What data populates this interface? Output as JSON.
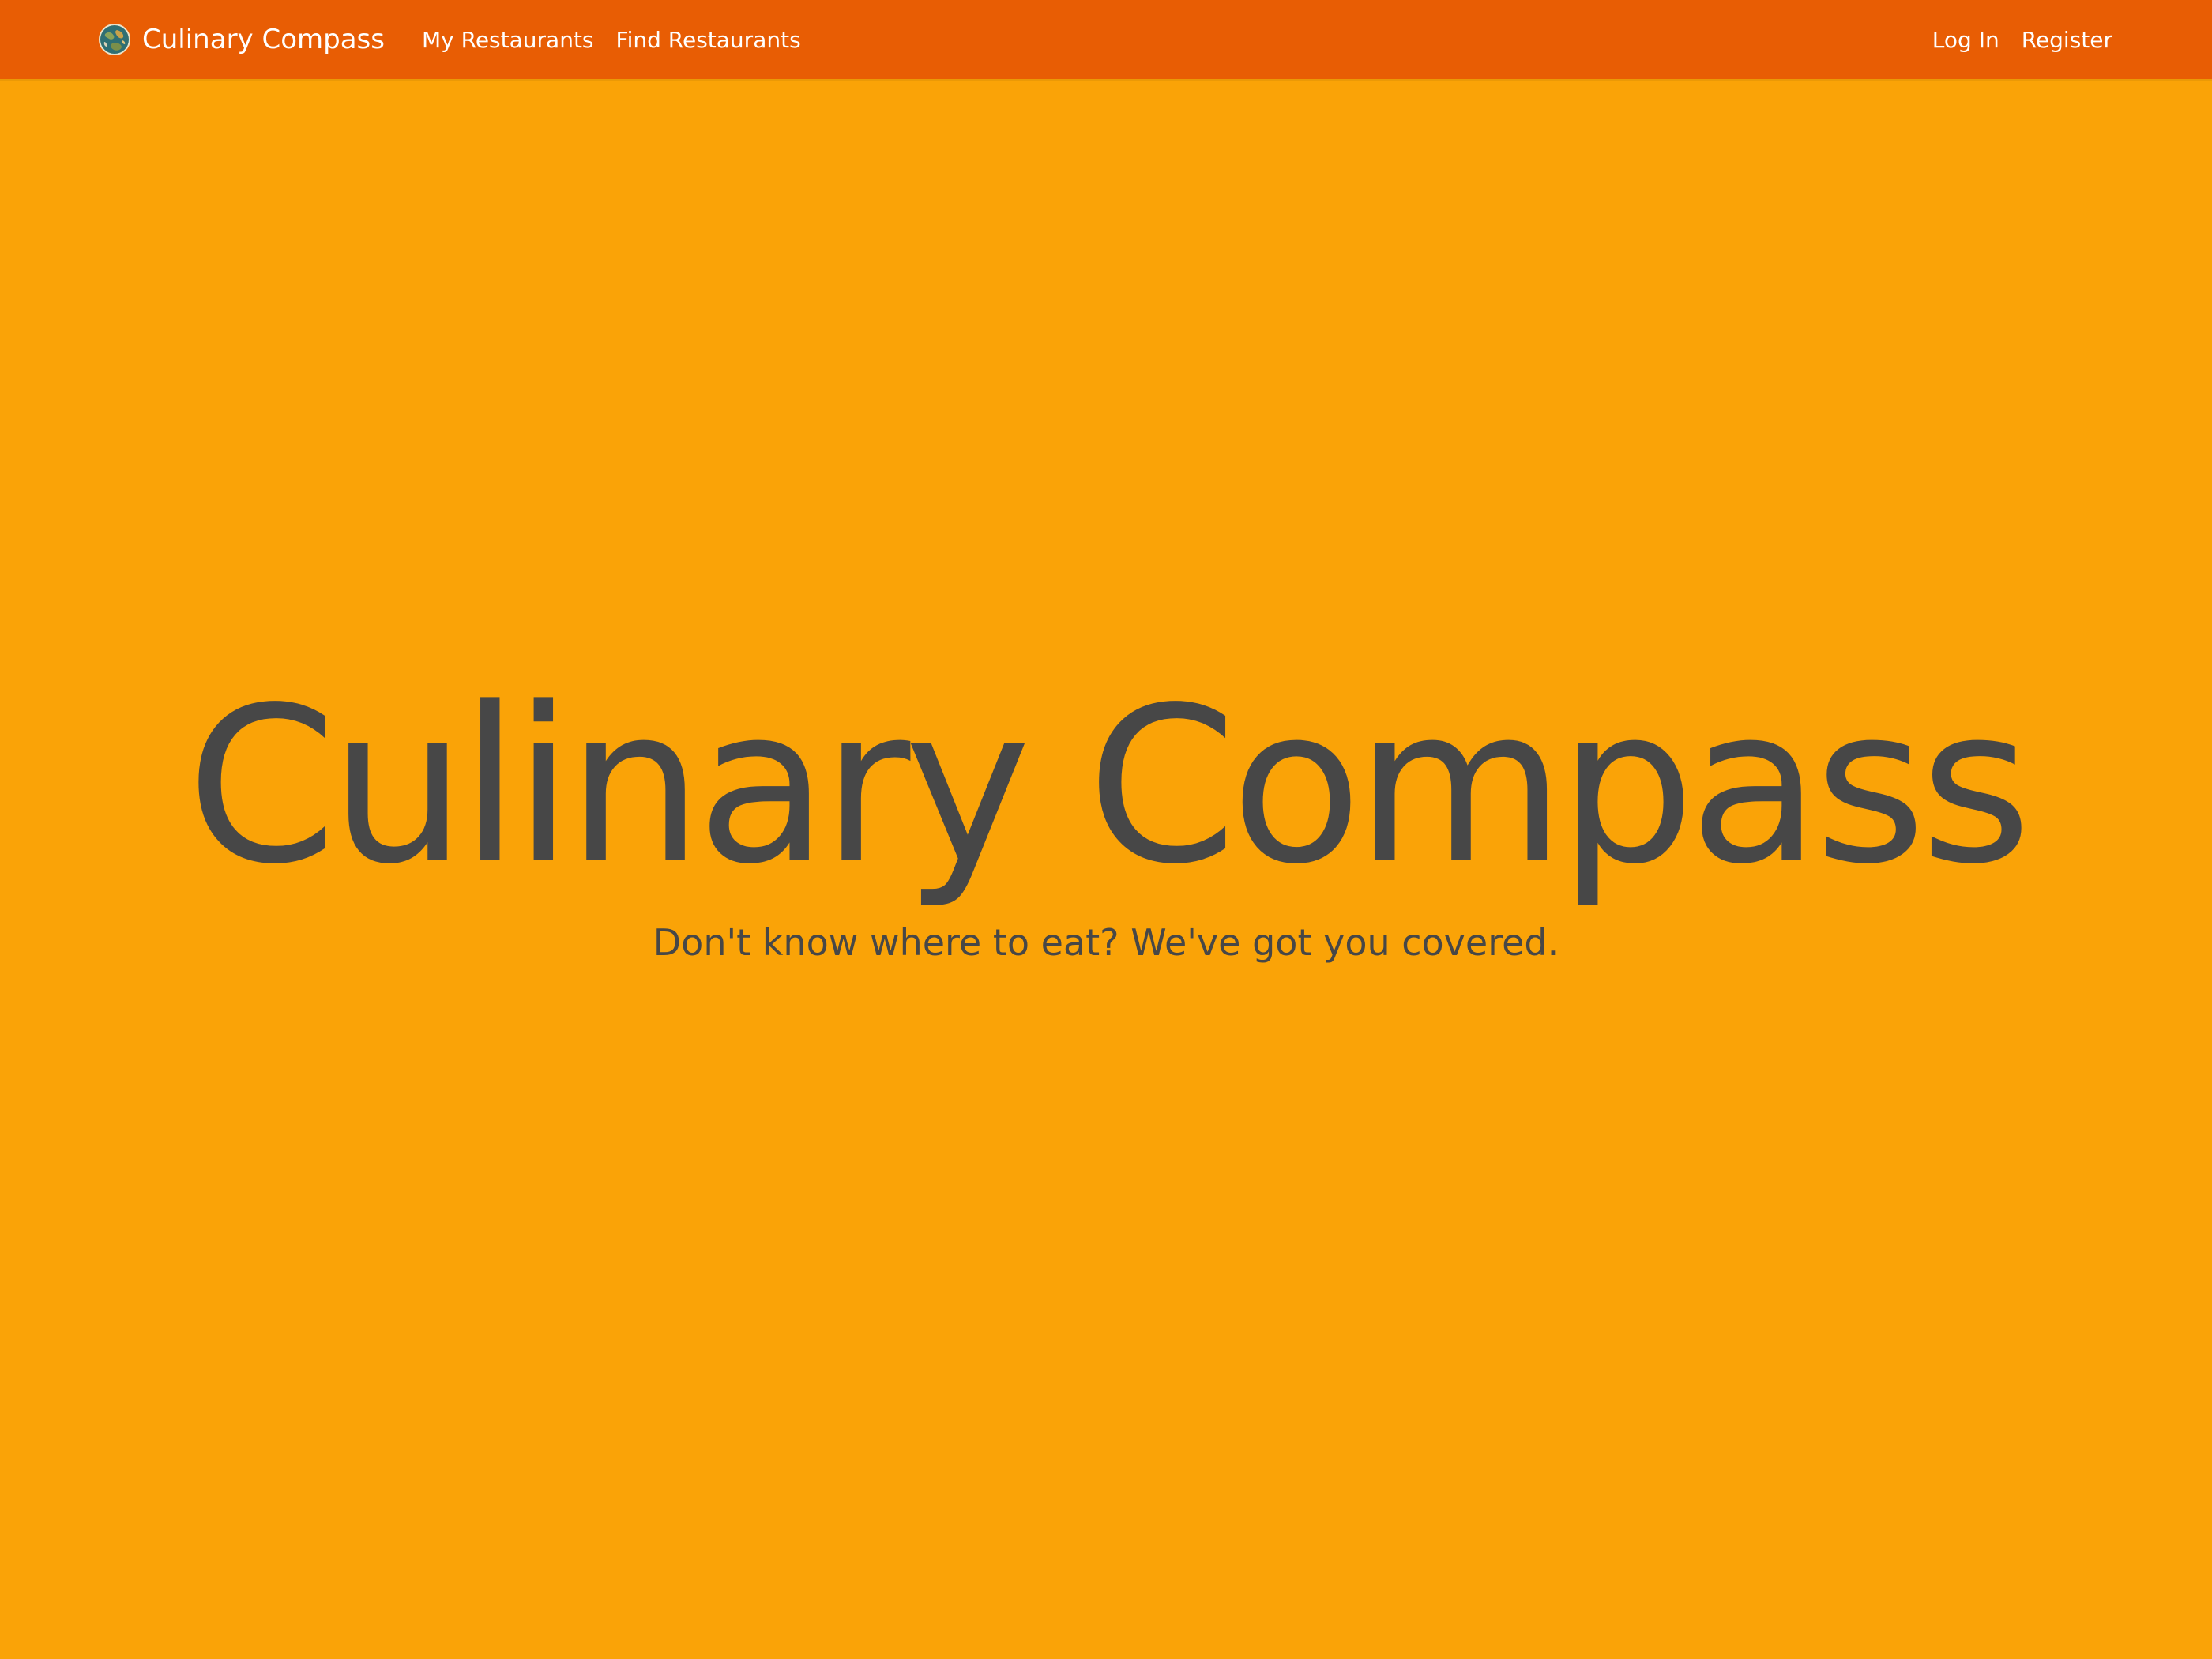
{
  "colors": {
    "navbar_bg": "#E85D04",
    "page_bg": "#FAA307",
    "hero_text": "#474747",
    "nav_text": "#FFFFFF"
  },
  "navbar": {
    "brand": {
      "icon": "globe-logo-icon",
      "label": "Culinary Compass"
    },
    "links_left": [
      {
        "label": "My Restaurants"
      },
      {
        "label": "Find Restaurants"
      }
    ],
    "links_right": [
      {
        "label": "Log In"
      },
      {
        "label": "Register"
      }
    ]
  },
  "hero": {
    "title": "Culinary Compass",
    "subtitle": "Don't know where to eat? We've got you covered."
  }
}
